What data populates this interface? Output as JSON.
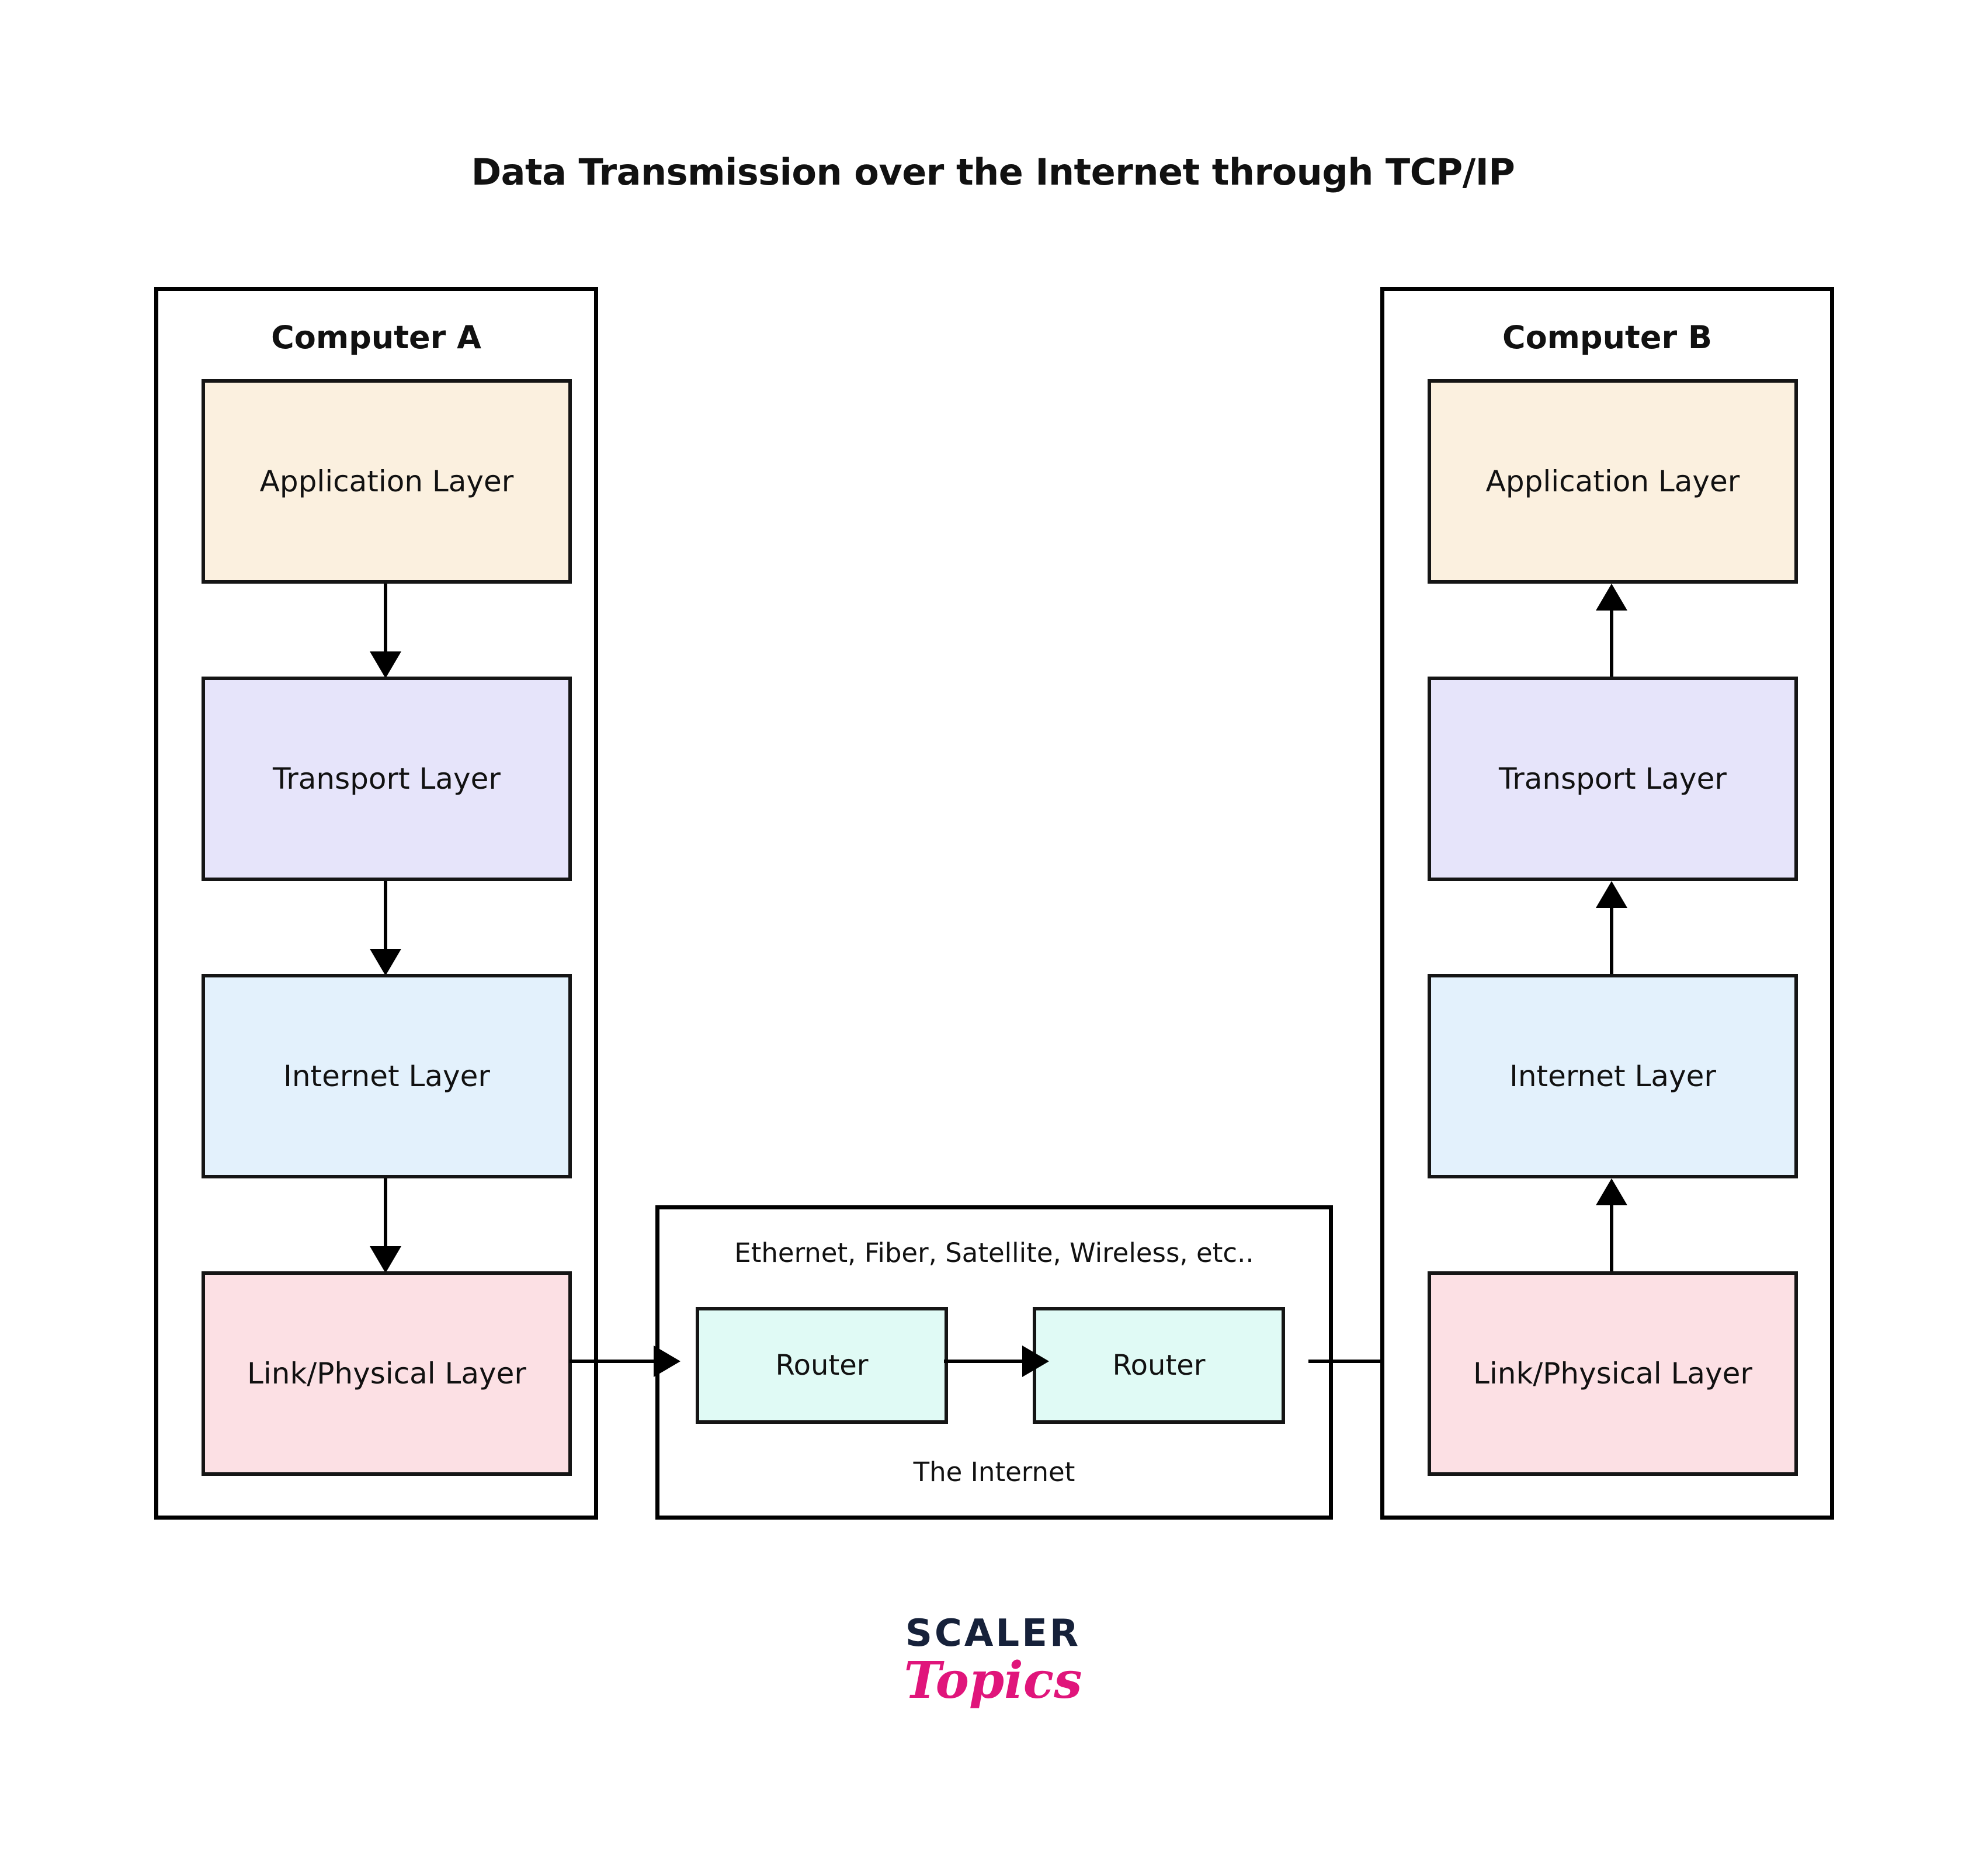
{
  "title": "Data Transmission over the Internet through TCP/IP",
  "computer_a": {
    "title": "Computer A",
    "flow_direction": "down",
    "layers": [
      {
        "label": "Application Layer",
        "color": "#FBF0DF"
      },
      {
        "label": "Transport Layer",
        "color": "#E6E4FA"
      },
      {
        "label": "Internet Layer",
        "color": "#E3F1FC"
      },
      {
        "label": "Link/Physical Layer",
        "color": "#FCE0E4"
      }
    ]
  },
  "computer_b": {
    "title": "Computer B",
    "flow_direction": "up",
    "layers": [
      {
        "label": "Application Layer",
        "color": "#FBF0DF"
      },
      {
        "label": "Transport Layer",
        "color": "#E6E4FA"
      },
      {
        "label": "Internet Layer",
        "color": "#E3F1FC"
      },
      {
        "label": "Link/Physical Layer",
        "color": "#FCE0E4"
      }
    ]
  },
  "internet": {
    "medium_label": "Ethernet, Fiber, Satellite, Wireless, etc..",
    "caption": "The Internet",
    "routers": [
      {
        "label": "Router",
        "color": "#E0FAF5"
      },
      {
        "label": "Router",
        "color": "#E0FAF5"
      }
    ]
  },
  "brand": {
    "primary": "SCALER",
    "secondary": "Topics",
    "primary_color": "#16213a",
    "secondary_color": "#e0157b"
  },
  "style": {
    "background": "#FFFFFF",
    "stroke": "#000000",
    "text": "#111111"
  }
}
